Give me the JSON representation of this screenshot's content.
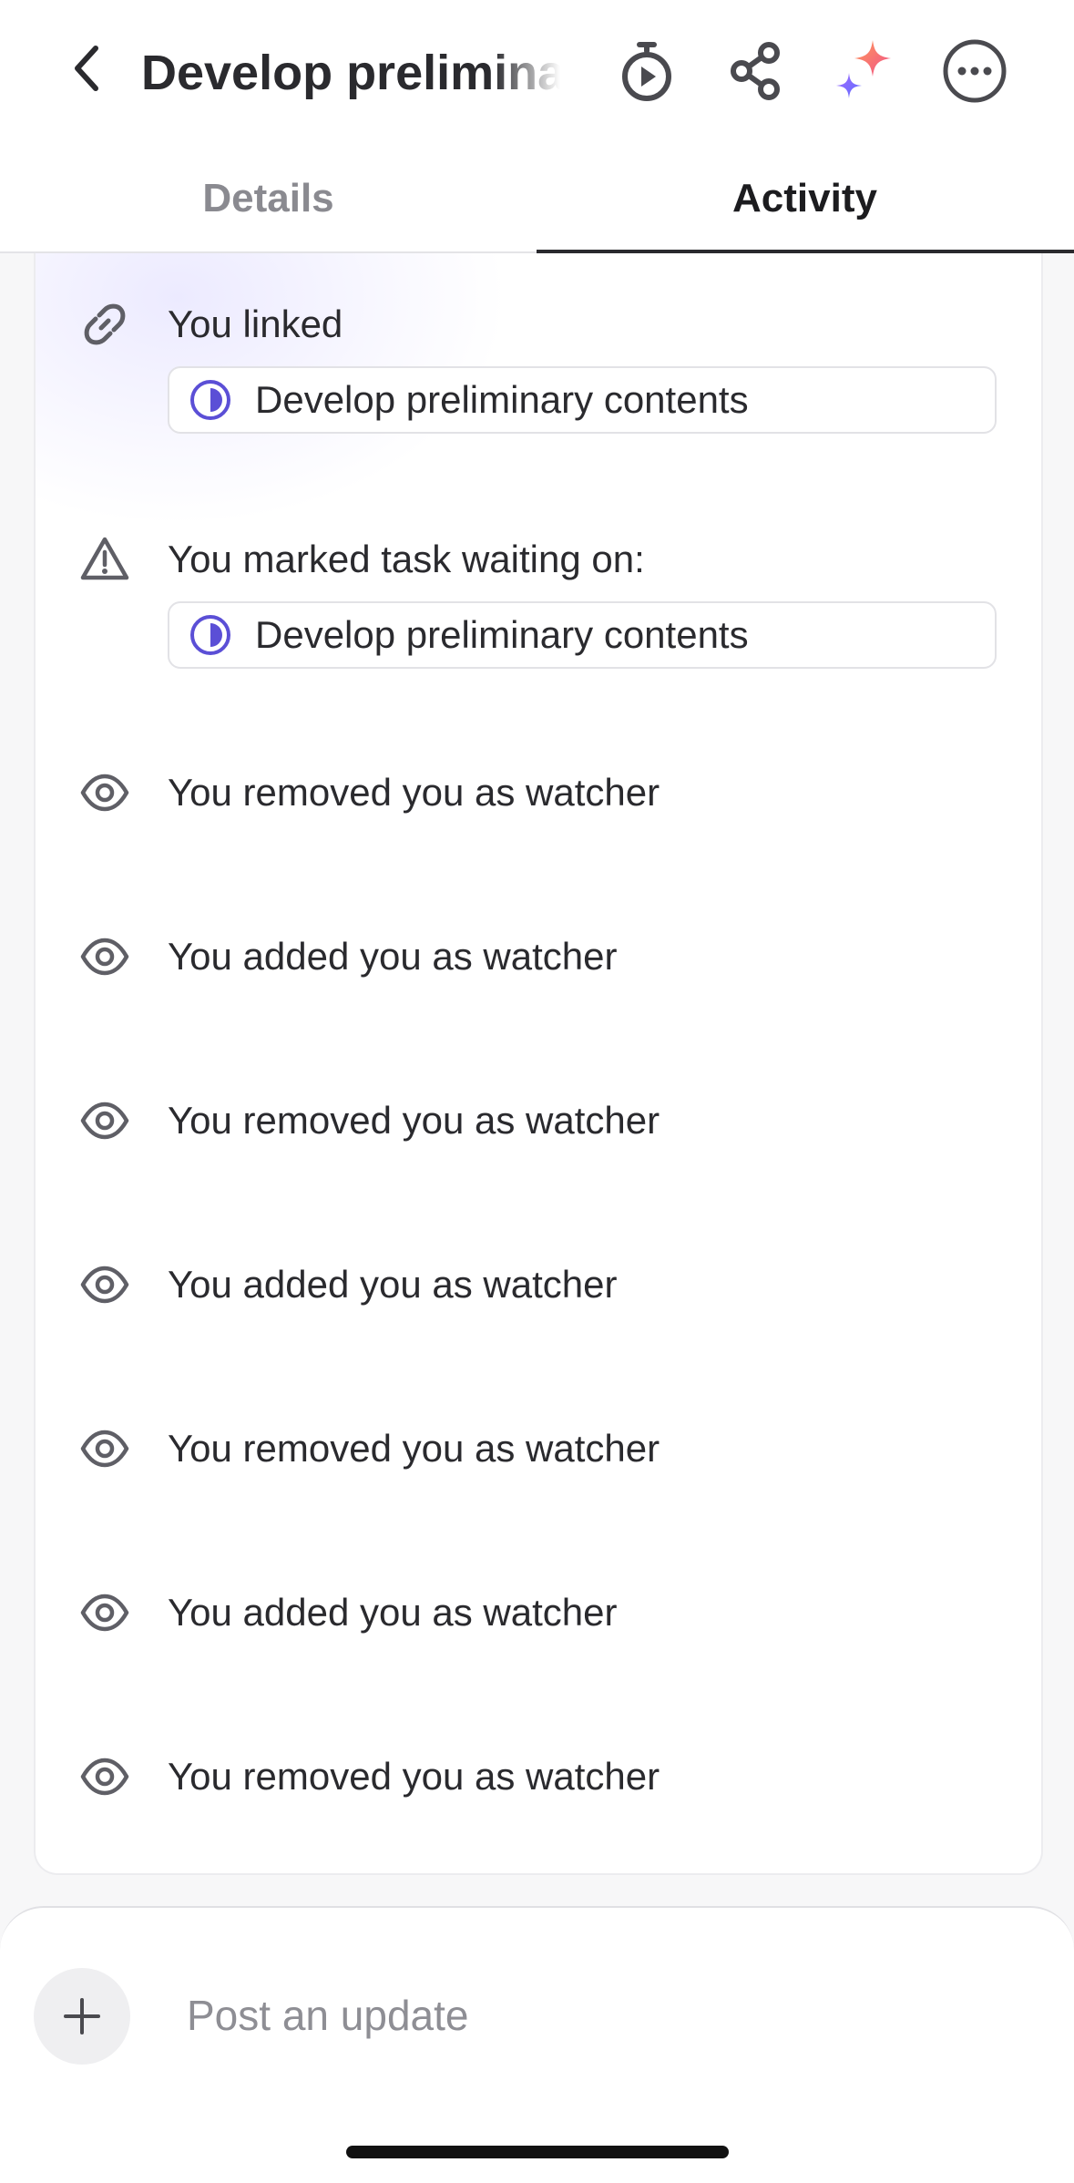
{
  "header": {
    "title": "Develop preliminary contents",
    "icons": [
      "back-chevron-icon",
      "timer-play-icon",
      "share-icon",
      "ai-sparkle-icon",
      "more-options-icon"
    ],
    "ai_colors": [
      "#f25c7a",
      "#7b61ff"
    ]
  },
  "tabs": [
    {
      "label": "Details",
      "active": false
    },
    {
      "label": "Activity",
      "active": true
    }
  ],
  "activity": [
    {
      "icon": "link-icon",
      "text": "You linked",
      "task": "Develop preliminary contents"
    },
    {
      "icon": "warning-icon",
      "text": "You marked task waiting on:",
      "task": "Develop preliminary contents"
    },
    {
      "icon": "eye-icon",
      "text": "You removed you as watcher"
    },
    {
      "icon": "eye-icon",
      "text": "You added you as watcher"
    },
    {
      "icon": "eye-icon",
      "text": "You removed you as watcher"
    },
    {
      "icon": "eye-icon",
      "text": "You added you as watcher"
    },
    {
      "icon": "eye-icon",
      "text": "You removed you as watcher"
    },
    {
      "icon": "eye-icon",
      "text": "You added you as watcher"
    },
    {
      "icon": "eye-icon",
      "text": "You removed you as watcher"
    }
  ],
  "task_status_color": "#5b4fd6",
  "composer": {
    "placeholder": "Post an update",
    "add_icon": "plus-icon"
  }
}
